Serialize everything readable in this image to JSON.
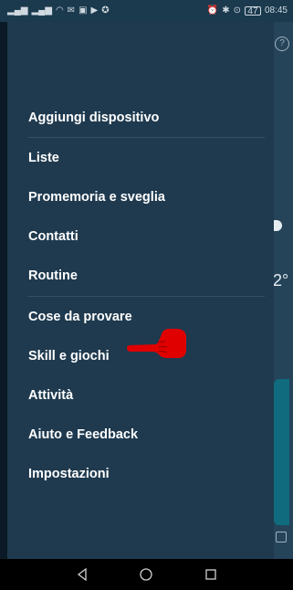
{
  "status": {
    "left_icons": [
      "signal-icon",
      "signal-icon",
      "wifi-icon",
      "mail-icon",
      "notification-icon",
      "play-icon",
      "shield-icon"
    ],
    "right_icons": [
      "alarm-icon",
      "bluetooth-icon",
      "location-icon"
    ],
    "battery": "47",
    "time": "08:45"
  },
  "background_app": {
    "temp": "2°",
    "help_symbol": "?"
  },
  "menu": {
    "items": [
      {
        "label": "Aggiungi dispositivo"
      },
      {
        "label": "Liste"
      },
      {
        "label": "Promemoria e sveglia"
      },
      {
        "label": "Contatti"
      },
      {
        "label": "Routine"
      },
      {
        "label": "Cose da provare"
      },
      {
        "label": "Skill e giochi"
      },
      {
        "label": "Attività"
      },
      {
        "label": "Aiuto e Feedback"
      },
      {
        "label": "Impostazioni"
      }
    ]
  },
  "navbar": {
    "back": "back-icon",
    "home": "home-icon",
    "recents": "recents-icon"
  },
  "colors": {
    "drawer": "#1f3a4f",
    "annotation": "#e00000"
  }
}
